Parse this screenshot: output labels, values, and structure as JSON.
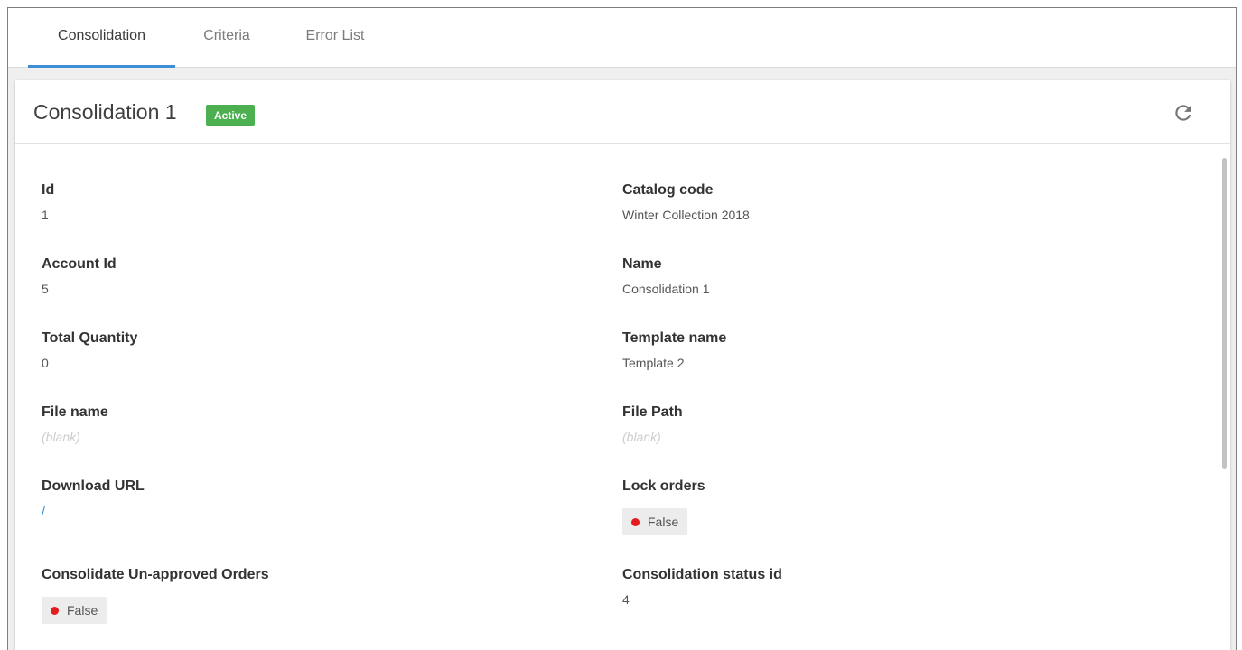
{
  "tabs": [
    {
      "label": "Consolidation"
    },
    {
      "label": "Criteria"
    },
    {
      "label": "Error List"
    }
  ],
  "header": {
    "title": "Consolidation 1",
    "status_badge": "Active",
    "refresh_icon": "refresh-icon"
  },
  "colors": {
    "accent": "#3d8fd1",
    "active_badge": "#4caf50",
    "false_dot": "#e51c1c",
    "link": "#2a8fd6"
  },
  "fields": {
    "id": {
      "label": "Id",
      "value": "1"
    },
    "catalog_code": {
      "label": "Catalog code",
      "value": "Winter Collection 2018"
    },
    "account_id": {
      "label": "Account Id",
      "value": "5"
    },
    "name": {
      "label": "Name",
      "value": "Consolidation 1"
    },
    "total_quantity": {
      "label": "Total Quantity",
      "value": "0"
    },
    "template_name": {
      "label": "Template name",
      "value": "Template 2"
    },
    "file_name": {
      "label": "File name",
      "value": "(blank)"
    },
    "file_path": {
      "label": "File Path",
      "value": "(blank)"
    },
    "download_url": {
      "label": "Download URL",
      "value": "/"
    },
    "lock_orders": {
      "label": "Lock orders",
      "value": "False"
    },
    "consolidate_unapproved": {
      "label": "Consolidate Un-approved Orders",
      "value": "False"
    },
    "consolidation_status_id": {
      "label": "Consolidation status id",
      "value": "4"
    }
  }
}
